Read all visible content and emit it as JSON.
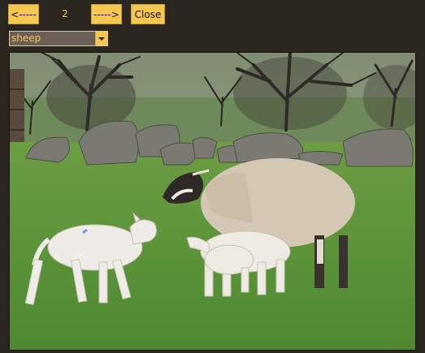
{
  "nav": {
    "prev_label": "<-----",
    "page_number": "2",
    "next_label": "----->",
    "close_label": "Close"
  },
  "category_select": {
    "selected": "sheep"
  },
  "photo": {
    "subject": "sheep-with-lambs"
  },
  "colors": {
    "background": "#2b2520",
    "button": "#f5c650",
    "accent_text": "#f5c650"
  }
}
